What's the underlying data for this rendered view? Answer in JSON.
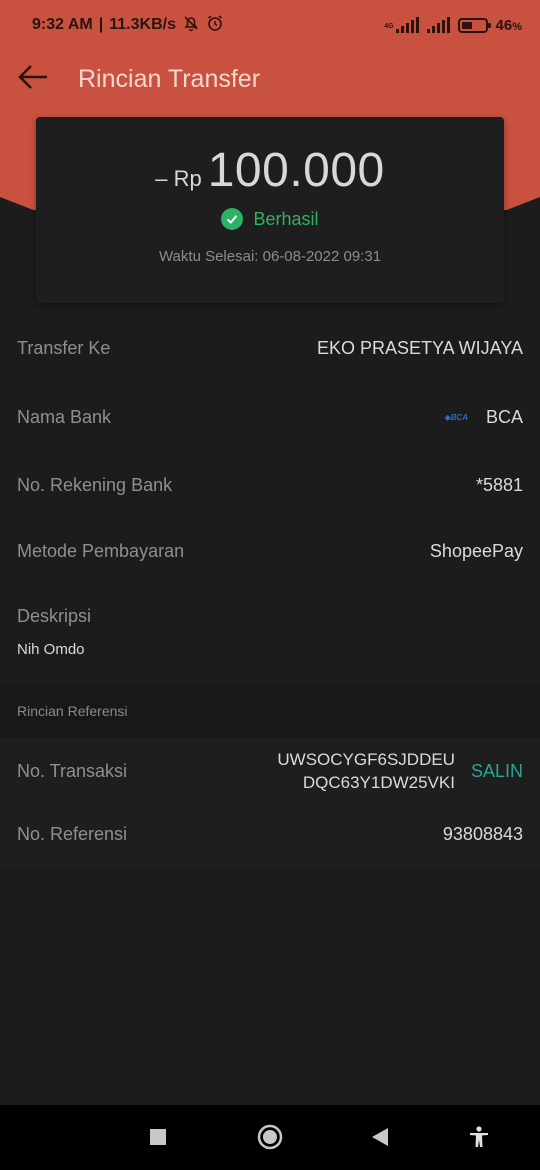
{
  "status_bar": {
    "time": "9:32 AM",
    "network_speed": "11.3KB/s",
    "battery": "46",
    "battery_unit": "%",
    "battery_level": 0.46,
    "network_type": "4G"
  },
  "header": {
    "title": "Rincian Transfer",
    "back_icon": "arrow-left-icon"
  },
  "amount": {
    "sign": "– Rp",
    "value": "100.000",
    "status": "Berhasil",
    "completed_time": "Waktu Selesai: 06-08-2022 09:31"
  },
  "details": {
    "transfer_to_label": "Transfer Ke",
    "transfer_to_value": "EKO PRASETYA WIJAYA",
    "bank_label": "Nama Bank",
    "bank_logo_text": "BCA",
    "bank_value": "BCA",
    "account_label": "No. Rekening Bank",
    "account_value": "*5881",
    "method_label": "Metode Pembayaran",
    "method_value": "ShopeePay",
    "description_label": "Deskripsi",
    "description_value": "Nih Omdo"
  },
  "reference": {
    "section_title": "Rincian Referensi",
    "transaction_label": "No. Transaksi",
    "transaction_line1": "UWSOCYGF6SJDDEU",
    "transaction_line2": "DQC63Y1DW25VKI",
    "copy_label": "SALIN",
    "reference_label": "No. Referensi",
    "reference_value": "93808843"
  },
  "colors": {
    "header_red": "#c9513f",
    "success_green": "#2fb064",
    "copy_teal": "#2aa597"
  },
  "nav": {
    "icons": [
      "recent-apps-icon",
      "home-icon",
      "back-icon",
      "accessibility-icon"
    ]
  }
}
